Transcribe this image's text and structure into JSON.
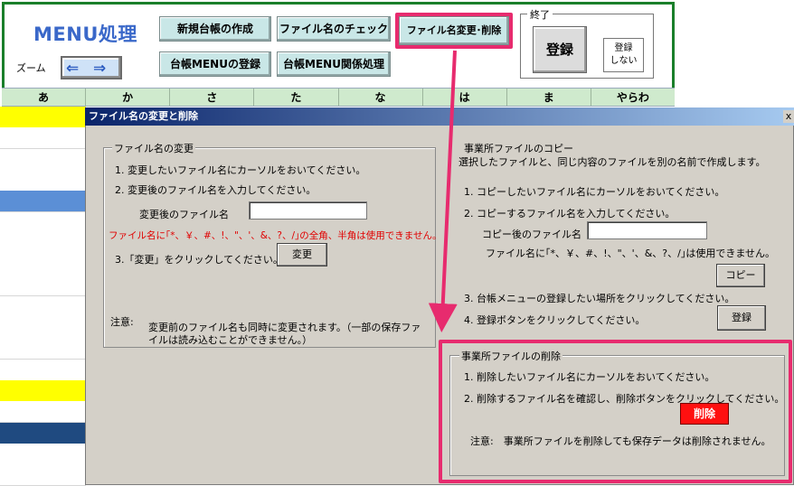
{
  "menu": {
    "title": "MENU処理",
    "zoom_label": "ズーム",
    "buttons": {
      "new_ledger": "新規台帳の作成",
      "filename_check": "ファイル名のチェック",
      "rename_delete": "ファイル名変更･削除",
      "ledger_menu_register": "台帳MENUの登録",
      "ledger_menu_related": "台帳MENU関係処理"
    },
    "end_group": {
      "legend": "終了",
      "register": "登録",
      "no_register_line1": "登録",
      "no_register_line2": "しない"
    }
  },
  "tabs": [
    "あ",
    "か",
    "さ",
    "た",
    "な",
    "は",
    "ま",
    "やらわ"
  ],
  "list_row_colors": [
    "#ffff00",
    "#ffffff",
    "#ffffff",
    "#ffffff",
    "#5b8fd6",
    "#ffffff",
    "#ffffff",
    "#ffffff",
    "#ffffff",
    "#ffffff",
    "#ffffff",
    "#ffffff",
    "#ffffff",
    "#ffff00",
    "#ffffff",
    "#1f4a80",
    "#ffffff",
    "#ffffff"
  ],
  "dialog": {
    "title": "ファイル名の変更と削除",
    "close": "x",
    "rename": {
      "legend": "ファイル名の変更",
      "step1": "1. 変更したいファイル名にカーソルをおいてください。",
      "step2": "2. 変更後のファイル名を入力してください。",
      "new_name_label": "変更後のファイル名",
      "warning": "ファイル名に｢*、￥、#、!、\"、'、&、?、/｣の全角、半角は使用できません。",
      "step3": "3.「変更」をクリックしてください。",
      "change_button": "変更",
      "note_label": "注意:",
      "note_line1": "変更前のファイル名も同時に変更されます。（一部の保存ファ",
      "note_line2": "イルは読み込むことができません。）"
    },
    "copy": {
      "legend": "事業所ファイルのコピー",
      "desc": "選択したファイルと、同じ内容のファイルを別の名前で作成します。",
      "step1": "1. コピーしたいファイル名にカーソルをおいてください。",
      "step2": "2. コピーするファイル名を入力してください。",
      "after_copy_label": "コピー後のファイル名",
      "warning": "ファイル名に｢*、￥、#、!、\"、'、&、?、/｣は使用できません。",
      "copy_button": "コピー",
      "step3": "3. 台帳メニューの登録したい場所をクリックしてください。",
      "step4": "4. 登録ボタンをクリックしてください。",
      "register_button": "登録"
    },
    "delete": {
      "legend": "事業所ファイルの削除",
      "step1": "1. 削除したいファイル名にカーソルをおいてください。",
      "step2": "2. 削除するファイル名を確認し、削除ボタンをクリックしてください。",
      "delete_button": "削除",
      "note": "注意:　事業所ファイルを削除しても保存データは削除されません。"
    }
  },
  "colors": {
    "highlight": "#e72b6e",
    "menu_frame": "#1a7f2a",
    "delete_button": "#ff1010",
    "title_blue": "#3a68c9"
  }
}
